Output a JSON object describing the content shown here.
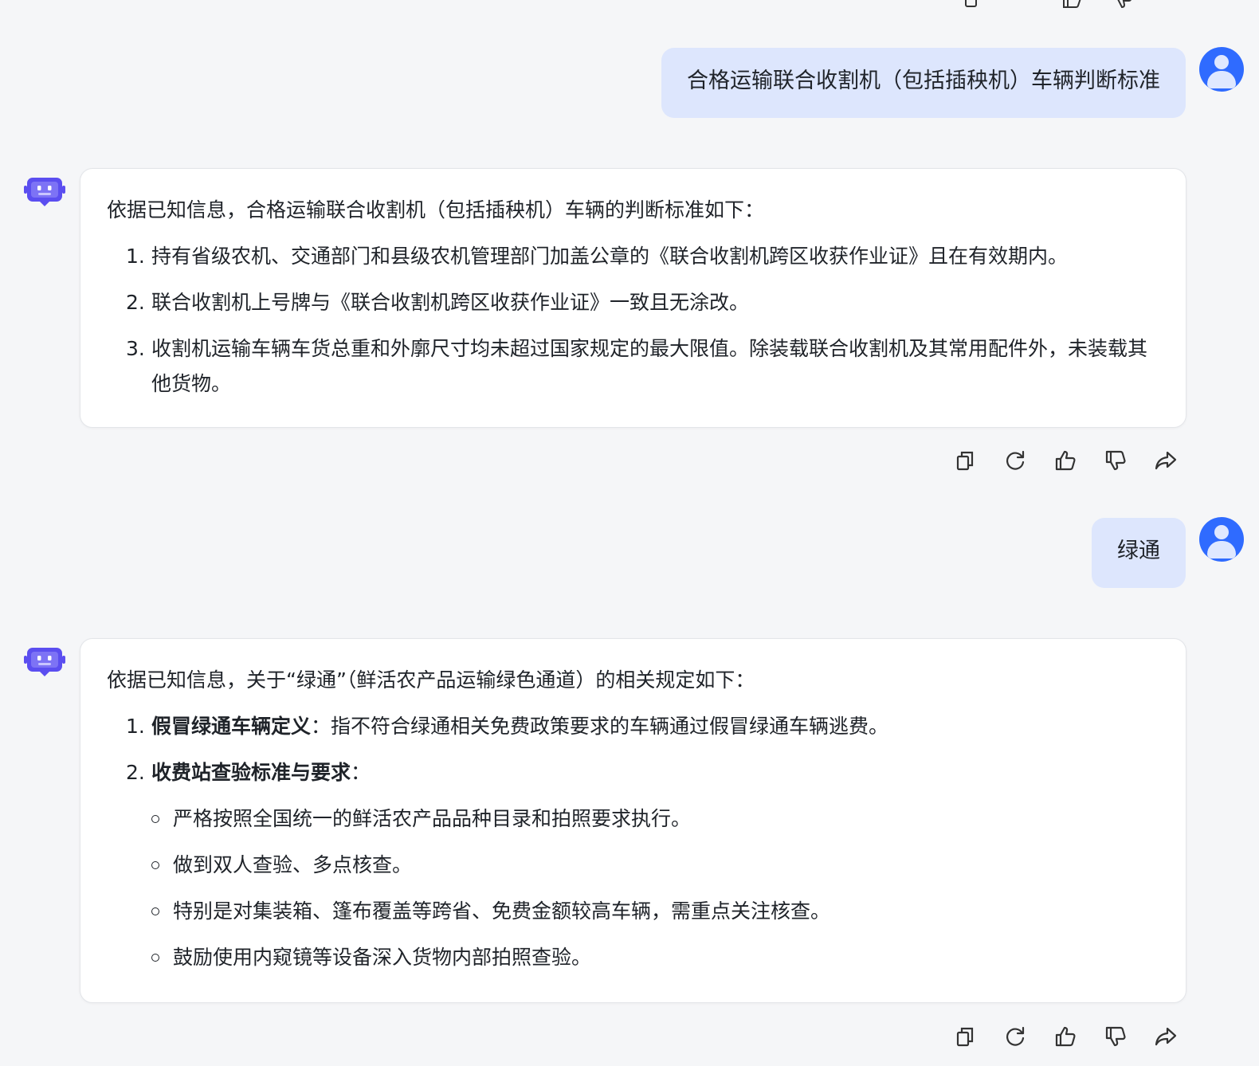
{
  "conversation": {
    "user_message_1": "合格运输联合收割机（包括插秧机）车辆判断标准",
    "bot_reply_1": {
      "intro": "依据已知信息，合格运输联合收割机（包括插秧机）车辆的判断标准如下：",
      "items": [
        {
          "num": "1.",
          "text": "持有省级农机、交通部门和县级农机管理部门加盖公章的《联合收割机跨区收获作业证》且在有效期内。"
        },
        {
          "num": "2.",
          "text": "联合收割机上号牌与《联合收割机跨区收获作业证》一致且无涂改。"
        },
        {
          "num": "3.",
          "text": "收割机运输车辆车货总重和外廓尺寸均未超过国家规定的最大限值。除装载联合收割机及其常用配件外，未装载其他货物。"
        }
      ]
    },
    "user_message_2": "绿通",
    "bot_reply_2": {
      "intro": "依据已知信息，关于“绿通”（鲜活农产品运输绿色通道）的相关规定如下：",
      "item1": {
        "num": "1.",
        "bold": "假冒绿通车辆定义",
        "text": "：指不符合绿通相关免费政策要求的车辆通过假冒绿通车辆逃费。"
      },
      "item2": {
        "num": "2.",
        "bold": "收费站查验标准与要求",
        "text": "："
      },
      "sub_items": [
        "严格按照全国统一的鲜活农产品品种目录和拍照要求执行。",
        "做到双人查验、多点核查。",
        "特别是对集装箱、篷布覆盖等跨省、免费金额较高车辆，需重点关注核查。",
        "鼓励使用内窥镜等设备深入货物内部拍照查验。"
      ]
    }
  },
  "actions": [
    "copy-icon",
    "refresh-icon",
    "thumbs-up-icon",
    "thumbs-down-icon",
    "share-icon"
  ],
  "colors": {
    "background": "#f5f6f8",
    "user_bubble": "#dde6fd",
    "avatar": "#2f6bff",
    "bot_icon": "#5b4ef0",
    "card": "#ffffff"
  }
}
